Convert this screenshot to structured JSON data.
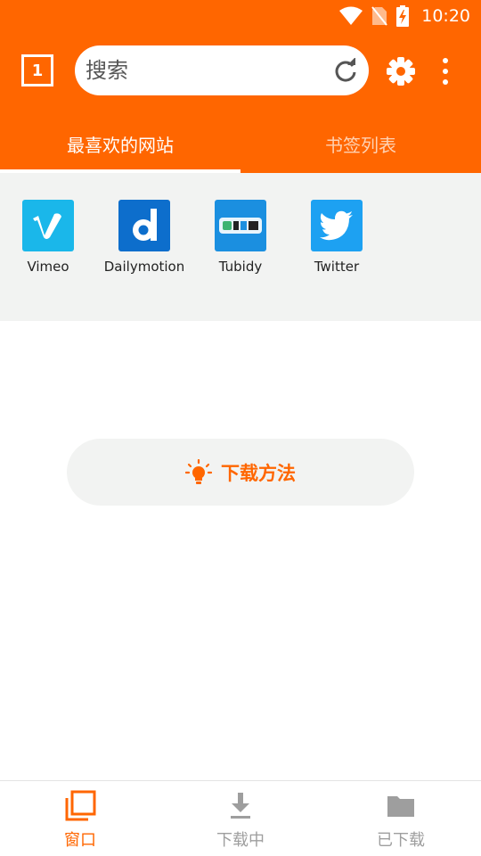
{
  "status_bar": {
    "time": "10:20",
    "icons": [
      "wifi-icon",
      "no-sim-icon",
      "battery-charging-icon"
    ]
  },
  "toolbar": {
    "tab_count": "1",
    "search_placeholder": "搜索",
    "icons": [
      "reload-icon",
      "gear-icon",
      "more-vertical-icon"
    ]
  },
  "tabs": [
    {
      "label": "最喜欢的网站",
      "active": true
    },
    {
      "label": "书签列表",
      "active": false
    }
  ],
  "favorites": [
    {
      "label": "Vimeo",
      "icon": "vimeo-icon",
      "color": "#1AB7EA"
    },
    {
      "label": "Dailymotion",
      "icon": "dailymotion-icon",
      "color": "#0D6ECC"
    },
    {
      "label": "Tubidy",
      "icon": "tubidy-icon",
      "color": "#1B8FE0"
    },
    {
      "label": "Twitter",
      "icon": "twitter-icon",
      "color": "#1DA1F2"
    }
  ],
  "howto": {
    "label": "下载方法",
    "icon": "lightbulb-icon"
  },
  "bottom_nav": [
    {
      "label": "窗口",
      "icon": "windows-icon",
      "active": true
    },
    {
      "label": "下载中",
      "icon": "download-icon",
      "active": false
    },
    {
      "label": "已下载",
      "icon": "folder-icon",
      "active": false
    }
  ],
  "colors": {
    "accent": "#FF6600",
    "panel": "#F2F3F2",
    "inactive": "#9E9E9E"
  }
}
